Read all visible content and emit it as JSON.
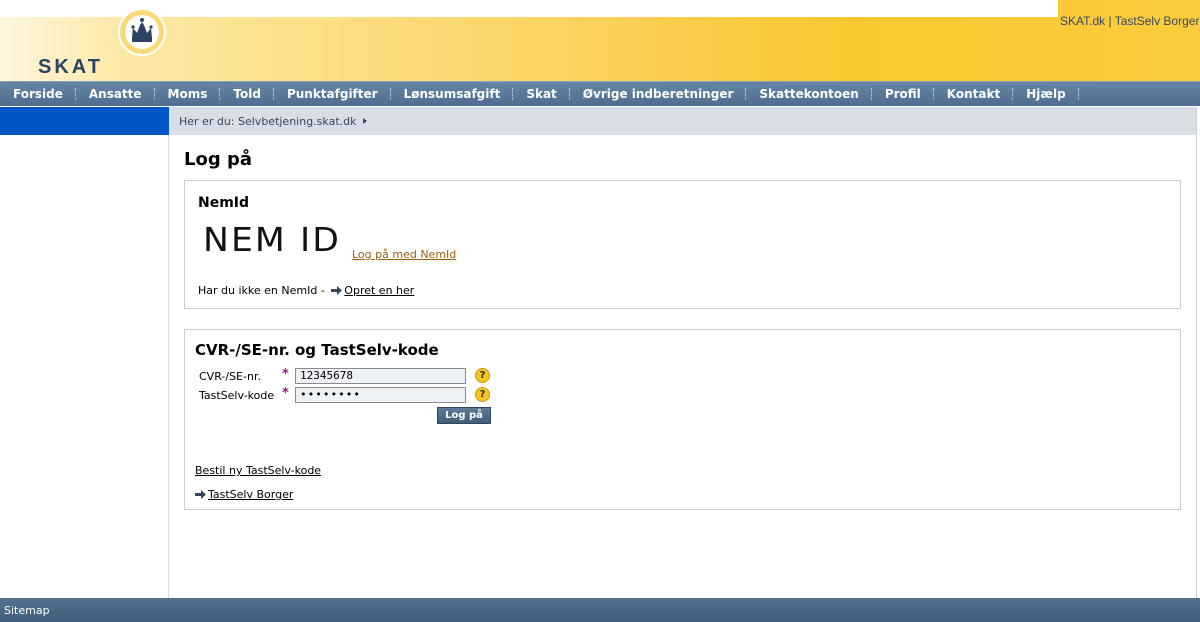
{
  "header": {
    "logo_text": "SKAT",
    "top_links": [
      {
        "label": "SKAT.dk"
      },
      {
        "label": "TastSelv Borger"
      }
    ],
    "separator": "|"
  },
  "nav": {
    "items": [
      "Forside",
      "Ansatte",
      "Moms",
      "Told",
      "Punktafgifter",
      "Lønsumsafgift",
      "Skat",
      "Øvrige indberetninger",
      "Skattekontoen",
      "Profil",
      "Kontakt",
      "Hjælp"
    ]
  },
  "breadcrumb": {
    "text": "Her er du: Selvbetjening.skat.dk"
  },
  "main": {
    "title": "Log på",
    "nemid": {
      "title": "NemId",
      "logo_text": "NEM ID",
      "login_link": "Log på med NemId",
      "question": "Har du ikke en NemId -",
      "create_link": "Opret en her"
    },
    "cvr": {
      "title": "CVR-/SE-nr. og TastSelv-kode",
      "cvr_label": "CVR-/SE-nr.",
      "cvr_value": "12345678",
      "code_label": "TastSelv-kode",
      "code_value": "••••••••",
      "required_mark": "*",
      "help_mark": "?",
      "login_button": "Log på",
      "order_code_link": "Bestil ny TastSelv-kode",
      "borger_link": "TastSelv Borger"
    }
  },
  "footer": {
    "sitemap": "Sitemap"
  },
  "colors": {
    "nav_bg": "#5a7b9b",
    "sidebar_accent": "#0157c8",
    "header_yellow": "#fac72f",
    "breadcrumb_bg": "#d8dde6",
    "required": "#8e1c8a",
    "nemid_link": "#9b5e10"
  },
  "icons": [
    "crown-icon",
    "arrow-right-icon",
    "help-icon",
    "breadcrumb-arrow-icon"
  ]
}
